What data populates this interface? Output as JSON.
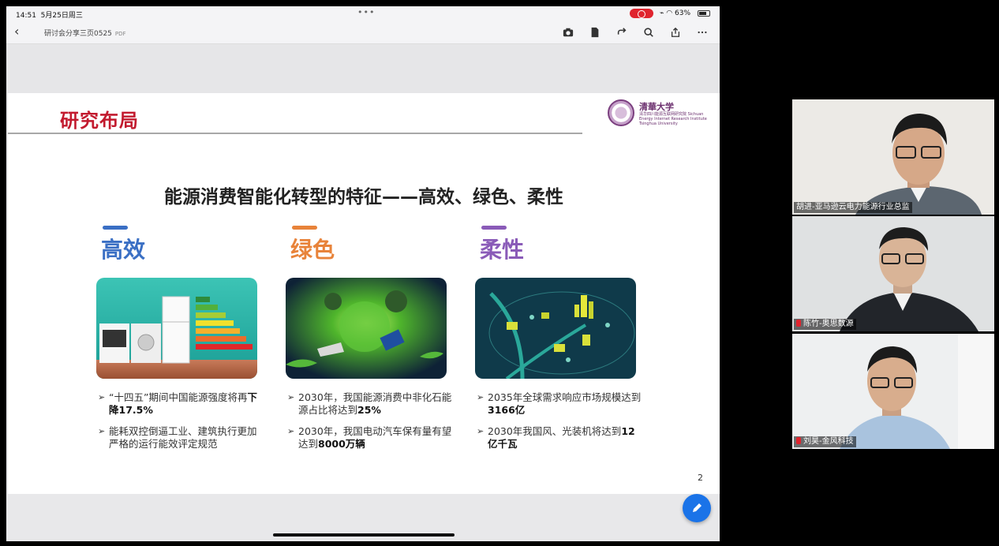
{
  "status_bar": {
    "time": "14:51",
    "date": "5月25日周三",
    "battery": "63%"
  },
  "nav": {
    "doc_title": "研讨会分享三页0525",
    "doc_type": "PDF"
  },
  "slide": {
    "heading": "研究布局",
    "logo_cn": "清華大学",
    "logo_en": "清华四川能源互联网研究院 Sichuan Energy Internet Research Institute Tsinghua University",
    "main_title": "能源消费智能化转型的特征——高效、绿色、柔性",
    "page_number": "2",
    "columns": [
      {
        "label": "高效",
        "color": "#3a6fc4",
        "bullets": [
          {
            "text": "“十四五”期间中国能源强度将再",
            "bold": "下降17.5%"
          },
          {
            "text": "能耗双控倒逼工业、建筑执行更加严格的运行能效评定规范",
            "bold": ""
          }
        ]
      },
      {
        "label": "绿色",
        "color": "#e8833a",
        "bullets": [
          {
            "text": "2030年，我国能源消费中非化石能源占比将达到",
            "bold": "25%"
          },
          {
            "text": "2030年，我国电动汽车保有量有望达到",
            "bold": "8000万辆"
          }
        ]
      },
      {
        "label": "柔性",
        "color": "#8a5bb8",
        "bullets": [
          {
            "text": "2035年全球需求响应市场规模达到",
            "bold": "3166亿"
          },
          {
            "text": "2030年我国风、光装机将达到",
            "bold": "12亿千瓦"
          }
        ]
      }
    ]
  },
  "participants": [
    {
      "name": "胡进-亚马逊云电力能源行业总监",
      "muted": false
    },
    {
      "name": "陈竹-奥思数源",
      "muted": true
    },
    {
      "name": "刘昊-金风科技",
      "muted": true
    }
  ]
}
